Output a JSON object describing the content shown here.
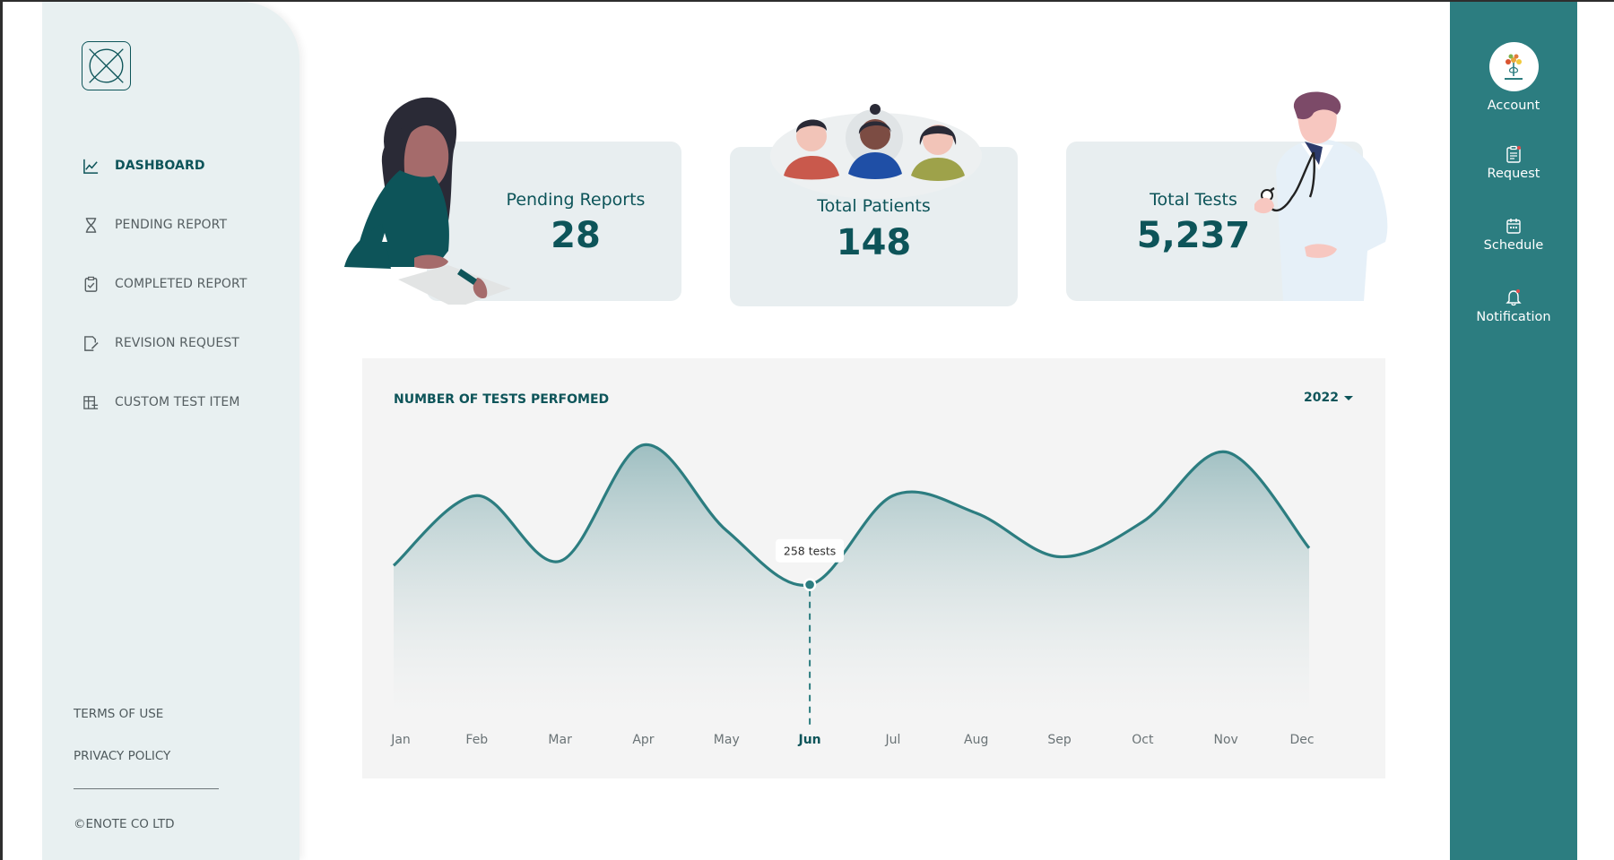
{
  "sidebar": {
    "items": [
      {
        "label": "DASHBOARD",
        "icon": "line-chart-icon",
        "active": true
      },
      {
        "label": "PENDING REPORT",
        "icon": "hourglass-icon",
        "active": false
      },
      {
        "label": "COMPLETED REPORT",
        "icon": "clipboard-check-icon",
        "active": false
      },
      {
        "label": "REVISION REQUEST",
        "icon": "document-edit-icon",
        "active": false
      },
      {
        "label": "CUSTOM TEST ITEM",
        "icon": "custom-item-icon",
        "active": false
      }
    ],
    "terms_label": "TERMS OF USE",
    "privacy_label": "PRIVACY POLICY",
    "copyright": "©ENOTE CO LTD"
  },
  "rightbar": {
    "account_label": "Account",
    "request_label": "Request",
    "schedule_label": "Schedule",
    "notification_label": "Notification"
  },
  "stats": {
    "pending": {
      "label": "Pending Reports",
      "value": "28"
    },
    "patients": {
      "label": "Total Patients",
      "value": "148"
    },
    "tests": {
      "label": "Total Tests",
      "value": "5,237"
    }
  },
  "chart": {
    "title": "NUMBER OF TESTS PERFOMED",
    "year": "2022",
    "tooltip": "258 tests",
    "highlight_month": "Jun"
  },
  "colors": {
    "primary": "#0d5459",
    "accent": "#2c7d80",
    "sidebar_bg": "#e8f0f1",
    "card_bg": "#e8eef0",
    "panel_bg": "#f4f4f4"
  },
  "chart_data": {
    "type": "area",
    "categories": [
      "Jan",
      "Feb",
      "Mar",
      "Apr",
      "May",
      "Jun",
      "Jul",
      "Aug",
      "Sep",
      "Oct",
      "Nov",
      "Dec"
    ],
    "series": [
      {
        "values": [
          280,
          360,
          285,
          418,
          320,
          258,
          360,
          340,
          290,
          330,
          410,
          300
        ]
      }
    ],
    "highlight": {
      "category": "Jun",
      "value": 258,
      "label": "258 tests"
    },
    "title": "NUMBER OF TESTS PERFOMED",
    "ylim": [
      150,
      430
    ],
    "grid": false
  }
}
